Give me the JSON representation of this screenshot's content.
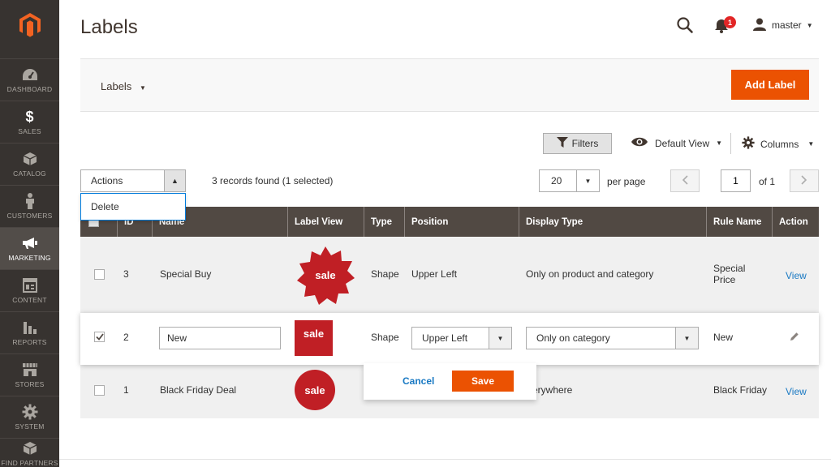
{
  "sidebar": {
    "items": [
      {
        "label": "DASHBOARD",
        "icon": "gauge-icon"
      },
      {
        "label": "SALES",
        "icon": "dollar-icon"
      },
      {
        "label": "CATALOG",
        "icon": "box-icon"
      },
      {
        "label": "CUSTOMERS",
        "icon": "person-icon"
      },
      {
        "label": "MARKETING",
        "icon": "megaphone-icon"
      },
      {
        "label": "CONTENT",
        "icon": "layout-icon"
      },
      {
        "label": "REPORTS",
        "icon": "bar-chart-icon"
      },
      {
        "label": "STORES",
        "icon": "storefront-icon"
      },
      {
        "label": "SYSTEM",
        "icon": "gear-icon"
      },
      {
        "label": "FIND PARTNERS",
        "icon": "cube-icon"
      }
    ]
  },
  "header": {
    "title": "Labels",
    "notifications": "1",
    "user": "master"
  },
  "page_actions": {
    "store_switch": "Labels",
    "add_label": "Add Label"
  },
  "toolbar": {
    "filters": "Filters",
    "view": "Default View",
    "columns": "Columns",
    "actions": "Actions",
    "action_menu_item": "Delete",
    "records": "3 records found (1 selected)",
    "per_page_value": "20",
    "per_page_label": "per page",
    "page": "1",
    "of": "of 1"
  },
  "table": {
    "headers": {
      "id": "ID",
      "name": "Name",
      "label_view": "Label View",
      "type": "Type",
      "position": "Position",
      "display_type": "Display Type",
      "rule_name": "Rule Name",
      "action": "Action"
    },
    "rows": [
      {
        "id": "3",
        "name": "Special Buy",
        "badge": "sale",
        "type": "Shape",
        "position": "Upper Left",
        "display_type": "Only on product and category",
        "rule_name_1": "Special",
        "rule_name_2": "Price",
        "action": "View"
      },
      {
        "id": "2",
        "name": "New",
        "badge": "sale",
        "type": "Shape",
        "position": "Upper Left",
        "display_type": "Only on category",
        "rule_name": "New"
      },
      {
        "id": "1",
        "name": "Black Friday Deal",
        "badge": "sale",
        "display_type_partial": "erywhere",
        "rule_name": "Black Friday",
        "action": "View"
      }
    ]
  },
  "edit": {
    "cancel": "Cancel",
    "save": "Save"
  },
  "colors": {
    "accent": "#eb5202",
    "sidebar": "#373330",
    "table_header": "#514943",
    "badge": "#c01f25",
    "link": "#1979c3"
  }
}
